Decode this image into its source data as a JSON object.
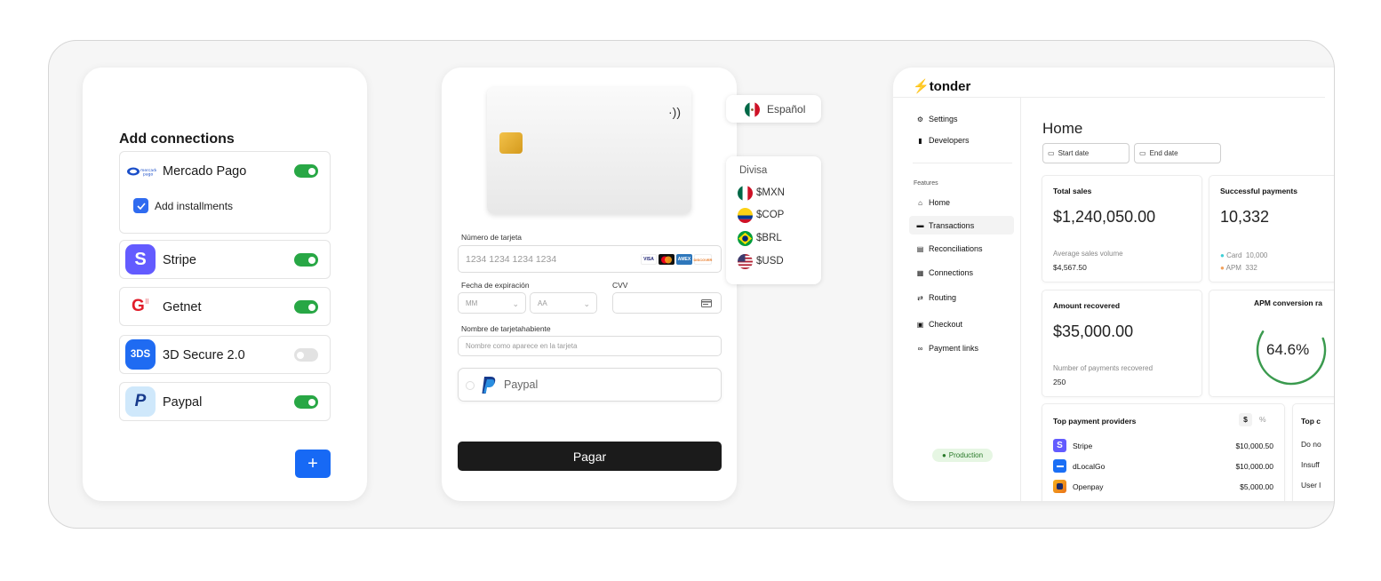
{
  "connections": {
    "title": "Add connections",
    "items": [
      {
        "name": "Mercado Pago",
        "enabled": true,
        "logo_text": "mercado pago"
      },
      {
        "name": "Stripe",
        "enabled": true,
        "logo_text": "S"
      },
      {
        "name": "Getnet",
        "enabled": true,
        "logo_text": "G"
      },
      {
        "name": "3D Secure 2.0",
        "enabled": false,
        "logo_text": "3DS"
      },
      {
        "name": "Paypal",
        "enabled": true,
        "logo_text": "P"
      }
    ],
    "installments_label": "Add installments",
    "add_button": "+"
  },
  "checkout": {
    "card_number_label": "Número de tarjeta",
    "card_number_placeholder": "1234 1234 1234 1234",
    "brands": [
      "VISA",
      "MC",
      "AMEX",
      "DISCOVER"
    ],
    "expiry_label": "Fecha de expiración",
    "month_placeholder": "MM",
    "year_placeholder": "AA",
    "cvv_label": "CVV",
    "holder_label": "Nombre de tarjetahabiente",
    "holder_placeholder": "Nombre como aparece en la tarjeta",
    "paypal_label": "Paypal",
    "pay_button": "Pagar",
    "language": "Español",
    "currency_title": "Divisa",
    "currencies": [
      "$MXN",
      "$COP",
      "$BRL",
      "$USD"
    ]
  },
  "dashboard": {
    "brand": "tonder",
    "top_nav": [
      "Settings",
      "Developers"
    ],
    "features_label": "Features",
    "nav": [
      "Home",
      "Transactions",
      "Reconciliations",
      "Connections",
      "Routing",
      "Checkout",
      "Payment links"
    ],
    "active_nav": "Transactions",
    "environment": "Production",
    "page_title": "Home",
    "start_date": "Start date",
    "end_date": "End date",
    "total_sales": {
      "title": "Total sales",
      "value": "$1,240,050.00",
      "sub_label": "Average sales volume",
      "sub_value": "$4,567.50"
    },
    "successful_payments": {
      "title": "Successful payments",
      "value": "10,332",
      "card_label": "Card",
      "card_value": "10,000",
      "apm_label": "APM",
      "apm_value": "332"
    },
    "amount_recovered": {
      "title": "Amount recovered",
      "value": "$35,000.00",
      "sub_label": "Number of payments recovered",
      "sub_value": "250"
    },
    "apm_conversion": {
      "title": "APM conversion ra",
      "value": "64.6%",
      "fraction": 0.646
    },
    "top_providers": {
      "title": "Top payment providers",
      "toggle": [
        "$",
        "%"
      ],
      "rows": [
        {
          "name": "Stripe",
          "amount": "$10,000.50"
        },
        {
          "name": "dLocalGo",
          "amount": "$10,000.00"
        },
        {
          "name": "Openpay",
          "amount": "$5,000.00"
        }
      ]
    },
    "top_c": {
      "title": "Top c",
      "rows": [
        "Do no",
        "Insuff",
        "User l"
      ]
    }
  },
  "colors": {
    "toggle_on": "#28a745",
    "accent": "#1769f5",
    "stripe": "#635bff"
  }
}
